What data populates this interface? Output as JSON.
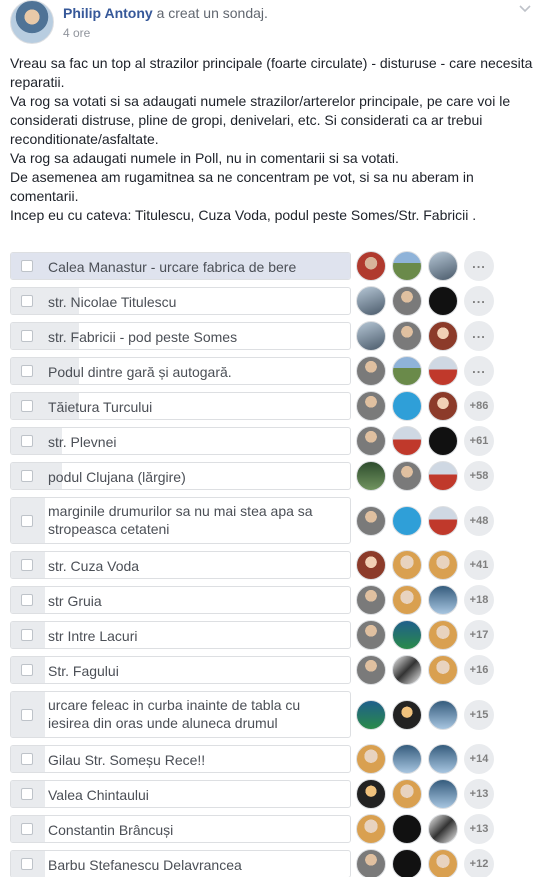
{
  "post": {
    "author": "Philip Antony",
    "action": " a creat un sondaj.",
    "timestamp": "4 ore",
    "paragraphs": [
      "Vreau sa fac un top al strazilor principale (foarte circulate) - disturuse - care necesita reparatii.",
      "Va rog sa votati si sa adaugati numele strazilor/arterelor principale, pe care voi le considerati distruse, pline de gropi, denivelari, etc. Si considerati ca ar trebui reconditionate/asfaltate.",
      "Va rog sa adaugati numele in Poll, nu in comentarii si sa votati.",
      "De asemenea am rugamitnea sa ne concentram pe vot, si sa nu aberam in comentarii.",
      "Incep eu cu cateva: Titulescu, Cuza Voda, podul peste Somes/Str. Fabricii ."
    ]
  },
  "icons": {
    "options_menu": "chevron-down-icon",
    "checkbox": "checkbox-icon",
    "voter": "avatar"
  },
  "colors": {
    "link": "#365899",
    "bar_fill": "#e9ebee",
    "lead_fill": "#dfe3ee",
    "border": "#dddfe2"
  },
  "poll": {
    "options": [
      {
        "label": "Calea Manastur - urcare fabrica de bere",
        "more": "...",
        "share": 1.0
      },
      {
        "label": "str. Nicolae Titulescu",
        "more": "...",
        "share": 0.2
      },
      {
        "label": "str. Fabricii - pod peste Somes",
        "more": "...",
        "share": 0.2
      },
      {
        "label": "Podul dintre gară și autogară.",
        "more": "...",
        "share": 0.2
      },
      {
        "label": "Tăietura Turcului",
        "more": "+86",
        "share": 0.2
      },
      {
        "label": "str. Plevnei",
        "more": "+61",
        "share": 0.15
      },
      {
        "label": "podul Clujana (lărgire)",
        "more": "+58",
        "share": 0.15
      },
      {
        "label": "marginile drumurilor sa nu mai stea apa sa stropeasca cetateni",
        "more": "+48",
        "share": 0.1
      },
      {
        "label": "str. Cuza Voda",
        "more": "+41",
        "share": 0.1
      },
      {
        "label": "str Gruia",
        "more": "+18",
        "share": 0.1
      },
      {
        "label": "str Intre Lacuri",
        "more": "+17",
        "share": 0.1
      },
      {
        "label": "Str. Fagului",
        "more": "+16",
        "share": 0.1
      },
      {
        "label": "urcare feleac in curba inainte de tabla cu iesirea din oras unde aluneca drumul",
        "more": "+15",
        "share": 0.1
      },
      {
        "label": "Gilau Str. Someșu Rece!!",
        "more": "+14",
        "share": 0.1
      },
      {
        "label": "Valea Chintaului",
        "more": "+13",
        "share": 0.1
      },
      {
        "label": "Constantin Brâncuși",
        "more": "+13",
        "share": 0.1
      },
      {
        "label": "Barbu Stefanescu Delavrancea",
        "more": "+12",
        "share": 0.1
      }
    ]
  }
}
